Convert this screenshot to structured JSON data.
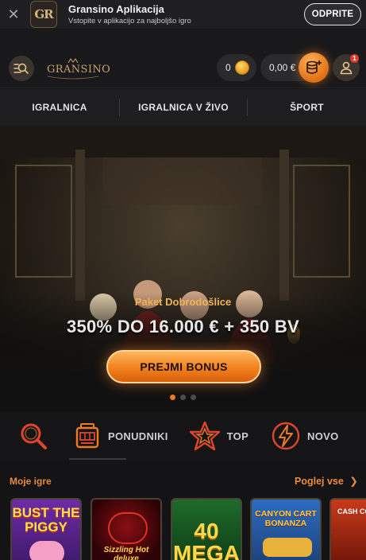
{
  "app_banner": {
    "title": "Gransino Aplikacija",
    "subtitle": "Vstopite v aplikacijo za najboljšo igro",
    "open_label": "ODPRITE",
    "logo_text": "GR"
  },
  "header": {
    "brand": "GRANSINO",
    "coins": "0",
    "balance": "0,00 €",
    "notification_count": "1"
  },
  "nav": {
    "tabs": [
      {
        "label": "IGRALNICA"
      },
      {
        "label": "IGRALNICA V ŽIVO"
      },
      {
        "label": "ŠPORT"
      }
    ]
  },
  "hero": {
    "promo_title": "Paket Dobrodošlice",
    "promo_main": "350% DO 16.000 € + 350 BV",
    "cta_label": "PREJMI BONUS",
    "slides": 3,
    "active_slide": 1
  },
  "categories": [
    {
      "label": "",
      "icon": "search-icon"
    },
    {
      "label": "PONUDNIKI",
      "icon": "slot-machine-icon"
    },
    {
      "label": "TOP",
      "icon": "star-icon"
    },
    {
      "label": "NOVO",
      "icon": "lightning-icon"
    }
  ],
  "my_games": {
    "title": "Moje igre",
    "see_all": "Poglej vse",
    "games": [
      {
        "name": "BUST THE PIGGY"
      },
      {
        "name": "Sizzling Hot deluxe"
      },
      {
        "name": "40 MEGA"
      },
      {
        "name": "CANYON CART BONANZA"
      },
      {
        "name": "CASH CON"
      }
    ]
  },
  "colors": {
    "accent": "#f07a20",
    "gold": "#c9a467",
    "background": "#141416"
  }
}
